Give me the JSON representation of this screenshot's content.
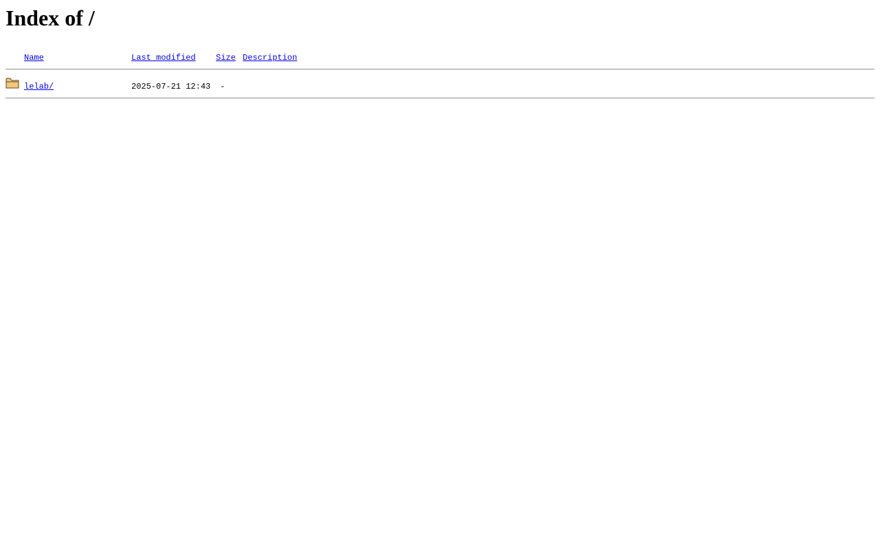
{
  "page": {
    "title": "Index of /"
  },
  "table": {
    "headers": {
      "name": "Name",
      "last_modified": "Last modified",
      "size": "Size",
      "description": "Description"
    },
    "rows": [
      {
        "icon": "folder-icon",
        "name": "lelab/",
        "last_modified": "2025-07-21 12:43",
        "size": "-",
        "description": ""
      }
    ]
  },
  "colors": {
    "link": "#0000ee",
    "text": "#000000",
    "rule": "#9a9a9a",
    "folder_fill": "#f3c67c",
    "folder_stroke": "#5a4a2a"
  }
}
